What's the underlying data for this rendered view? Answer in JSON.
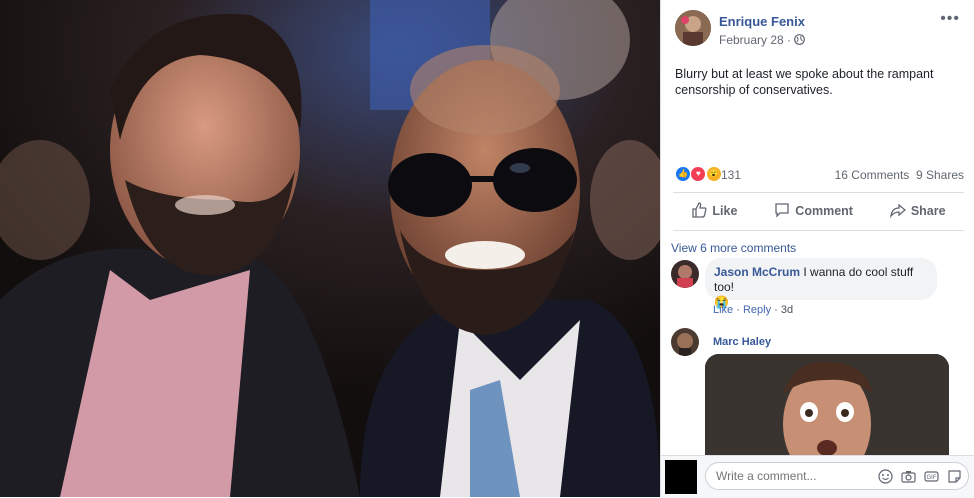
{
  "post": {
    "author": "Enrique Fenix",
    "date": "February 28",
    "privacy_icon": "globe-icon",
    "caption": "Blurry but at least we spoke about the rampant censorship of conservatives.",
    "reaction_count": "131",
    "comments_count": "16 Comments",
    "shares_count": "9 Shares"
  },
  "actions": {
    "like": "Like",
    "comment": "Comment",
    "share": "Share"
  },
  "comments": {
    "view_more": "View 6 more comments",
    "items": [
      {
        "author": "Jason McCrum",
        "text": "I wanna do cool stuff too!",
        "emoji": "😭",
        "like": "Like",
        "reply": "Reply",
        "time": "3d"
      },
      {
        "author": "Marc Haley"
      }
    ]
  },
  "composer": {
    "placeholder": "Write a comment..."
  },
  "colors": {
    "link": "#385898",
    "reaction_like": "#1877f2",
    "reaction_love": "#f33e58",
    "reaction_wow": "#f7b125"
  }
}
